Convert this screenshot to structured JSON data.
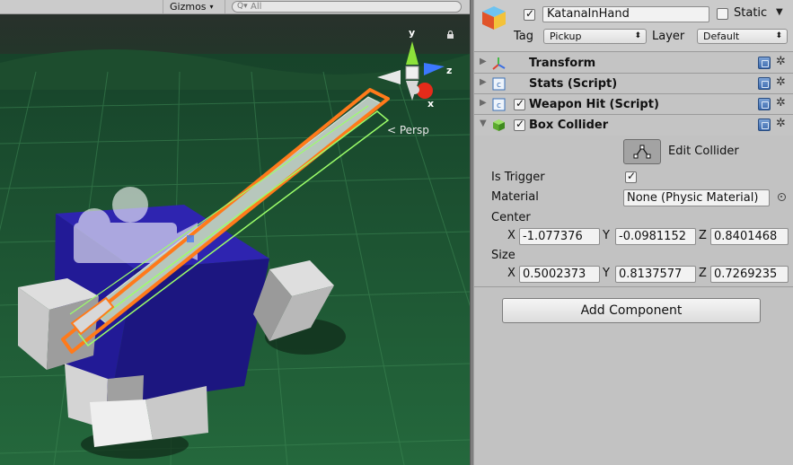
{
  "scene": {
    "gizmos_label": "Gizmos",
    "gizmos_caret": "▾",
    "search_placeholder": "All",
    "search_icon_glyph": "Q▾",
    "persp_label": "< Persp",
    "axes": {
      "y": "y",
      "z": "z",
      "x": "x"
    }
  },
  "inspector": {
    "object_active": true,
    "object_name": "KatanaInHand",
    "static_label": "Static",
    "static_checked": false,
    "static_caret": "▼",
    "tag_label": "Tag",
    "tag_value": "Pickup",
    "layer_label": "Layer",
    "layer_value": "Default",
    "select_arrow": "⬍",
    "components": [
      {
        "title": "Transform",
        "expanded": false,
        "has_toggle": false,
        "icon": "transform-icon"
      },
      {
        "title": "Stats (Script)",
        "expanded": false,
        "has_toggle": false,
        "icon": "script-icon"
      },
      {
        "title": "Weapon Hit (Script)",
        "expanded": false,
        "has_toggle": true,
        "enabled": true,
        "icon": "script-icon"
      },
      {
        "title": "Box Collider",
        "expanded": true,
        "has_toggle": true,
        "enabled": true,
        "icon": "box-collider-icon"
      }
    ],
    "fold_collapsed": "▶",
    "fold_expanded": "▼",
    "gear_glyph": "✲",
    "check_glyph": "✓",
    "box_collider": {
      "edit_collider_label": "Edit Collider",
      "is_trigger_label": "Is Trigger",
      "is_trigger_checked": true,
      "material_label": "Material",
      "material_value": "None (Physic Material)",
      "center_label": "Center",
      "center": {
        "x": "-1.077376",
        "y": "-0.0981152",
        "z": "0.8401468"
      },
      "size_label": "Size",
      "size": {
        "x": "0.5002373",
        "y": "0.8137577",
        "z": "0.7269235"
      },
      "axis_labels": {
        "x": "X",
        "y": "Y",
        "z": "Z"
      }
    },
    "add_component_label": "Add Component"
  },
  "colors": {
    "ground": "#1e4a2c",
    "body_blue": "#22188e",
    "collider_orange": "#ff7a1a",
    "collider_green": "#9cff6a",
    "inspector_bg": "#c2c2c2"
  }
}
